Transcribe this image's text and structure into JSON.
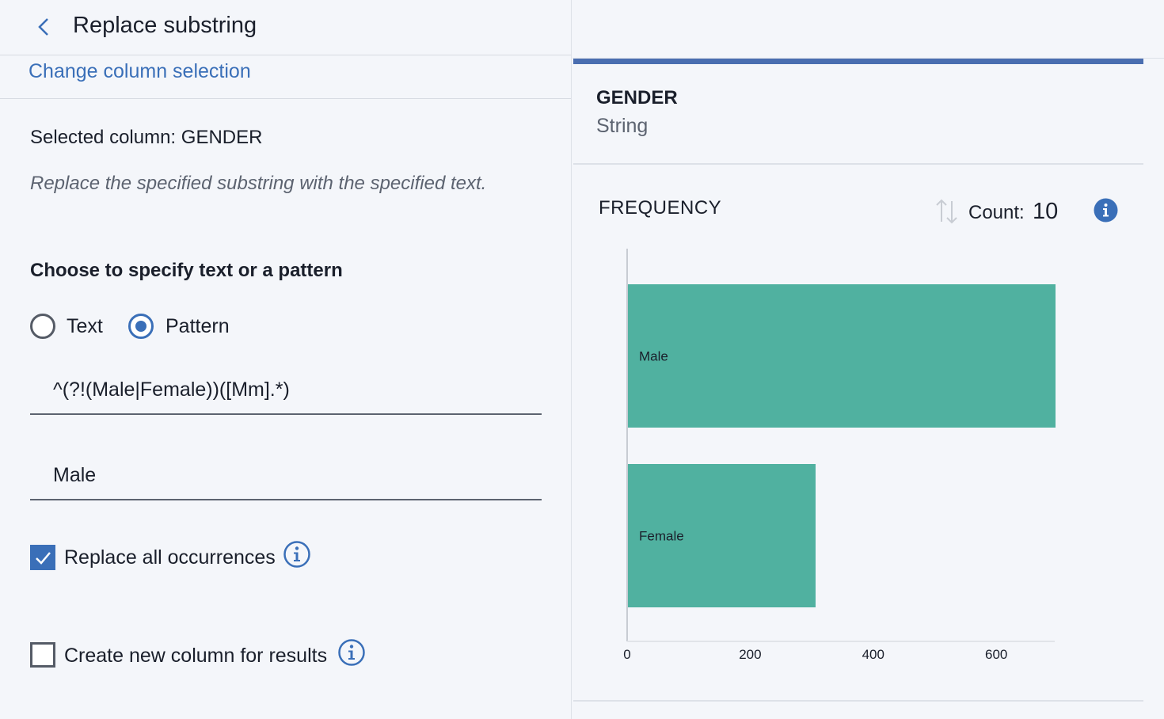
{
  "header": {
    "title": "Replace substring"
  },
  "links": {
    "change_column": "Change column selection"
  },
  "operation": {
    "selected_column": "Selected column: GENDER",
    "description": "Replace the specified substring with the specified text.",
    "section_title": "Choose to specify text or a pattern",
    "mode_options": [
      {
        "label": "Text",
        "selected": false
      },
      {
        "label": "Pattern",
        "selected": true
      }
    ],
    "pattern_value": "^(?!(Male|Female))([Mm].*)",
    "replacement_value": "Male",
    "replace_all": {
      "label": "Replace all occurrences",
      "checked": true
    },
    "create_new_column": {
      "label": "Create new column for results",
      "checked": false
    }
  },
  "profile": {
    "column_name": "GENDER",
    "column_type": "String",
    "frequency_title": "FREQUENCY",
    "count_label": "Count:",
    "count_value": "10"
  },
  "colors": {
    "accent": "#3a6fb8",
    "card_top_border": "#4a6eb0",
    "bar_fill": "#50b1a0"
  },
  "icons": {
    "back": "chevron-left-icon",
    "info_outline": "info-circle-outline-icon",
    "info_filled": "info-circle-filled-icon",
    "sort": "sort-arrows-icon",
    "check": "checkmark-icon"
  },
  "chart_data": {
    "type": "bar",
    "orientation": "horizontal",
    "categories": [
      "Male",
      "Female"
    ],
    "values": [
      695,
      305
    ],
    "xlim": [
      0,
      695
    ],
    "xticks": [
      0,
      200,
      400,
      600
    ],
    "title": "",
    "xlabel": "",
    "ylabel": ""
  }
}
